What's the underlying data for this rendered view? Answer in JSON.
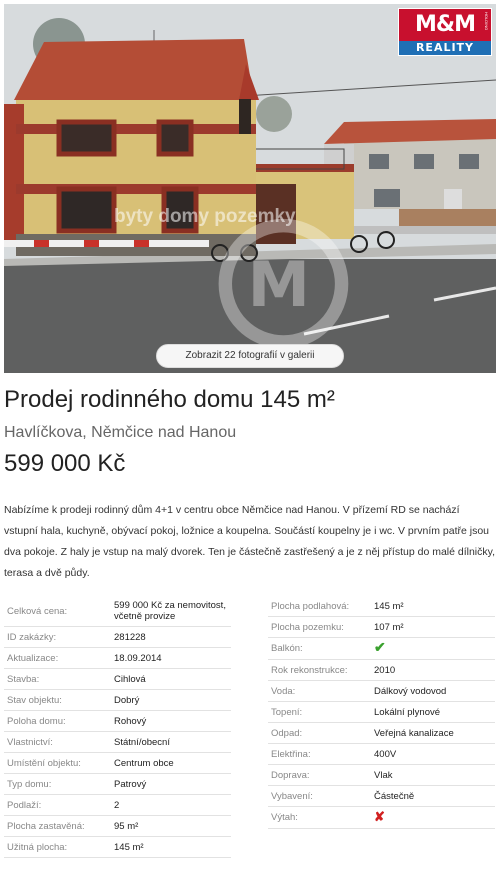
{
  "photo": {
    "logo_top": "M&M",
    "logo_bottom": "REALITY",
    "logo_side": "HOLDING",
    "watermark": "byty domy pozemky",
    "gallery_button": "Zobrazit 22 fotografií v galerii"
  },
  "listing": {
    "title": "Prodej rodinného domu 145 m²",
    "address": "Havlíčkova, Němčice nad Hanou",
    "price": "599 000 Kč",
    "description": "Nabízíme k prodeji rodinný dům 4+1 v centru obce Němčice nad Hanou. V přízemí RD se nachází vstupní hala, kuchyně, obývací pokoj, ložnice a koupelna. Součástí koupelny je i wc. V prvním patře jsou dva pokoje. Z haly je vstup na malý dvorek. Ten je částečně zastřešený a je z něj přístup do malé dílničky, terasa a dvě půdy."
  },
  "params_left": [
    {
      "label": "Celková cena:",
      "value": "599 000 Kč za nemovitost, včetně provize"
    },
    {
      "label": "ID zakázky:",
      "value": "281228"
    },
    {
      "label": "Aktualizace:",
      "value": "18.09.2014"
    },
    {
      "label": "Stavba:",
      "value": "Cihlová"
    },
    {
      "label": "Stav objektu:",
      "value": "Dobrý"
    },
    {
      "label": "Poloha domu:",
      "value": "Rohový"
    },
    {
      "label": "Vlastnictví:",
      "value": "Státní/obecní"
    },
    {
      "label": "Umístění objektu:",
      "value": "Centrum obce"
    },
    {
      "label": "Typ domu:",
      "value": "Patrový"
    },
    {
      "label": "Podlaží:",
      "value": "2"
    },
    {
      "label": "Plocha zastavěná:",
      "value": "95 m²"
    },
    {
      "label": "Užitná plocha:",
      "value": "145 m²"
    }
  ],
  "params_right": [
    {
      "label": "Plocha podlahová:",
      "value": "145 m²"
    },
    {
      "label": "Plocha pozemku:",
      "value": "107 m²"
    },
    {
      "label": "Balkón:",
      "value": "✔",
      "icon": "check-icon"
    },
    {
      "label": "Rok rekonstrukce:",
      "value": "2010"
    },
    {
      "label": "Voda:",
      "value": "Dálkový vodovod"
    },
    {
      "label": "Topení:",
      "value": "Lokální plynové"
    },
    {
      "label": "Odpad:",
      "value": "Veřejná kanalizace"
    },
    {
      "label": "Elektřina:",
      "value": "400V"
    },
    {
      "label": "Doprava:",
      "value": "Vlak"
    },
    {
      "label": "Vybavení:",
      "value": "Částečně"
    },
    {
      "label": "Výtah:",
      "value": "✘",
      "icon": "cross-icon"
    }
  ],
  "colors": {
    "logo_red": "#c8102e",
    "logo_blue": "#1f6fb5",
    "check_green": "#3aa12e",
    "cross_red": "#d12020"
  }
}
